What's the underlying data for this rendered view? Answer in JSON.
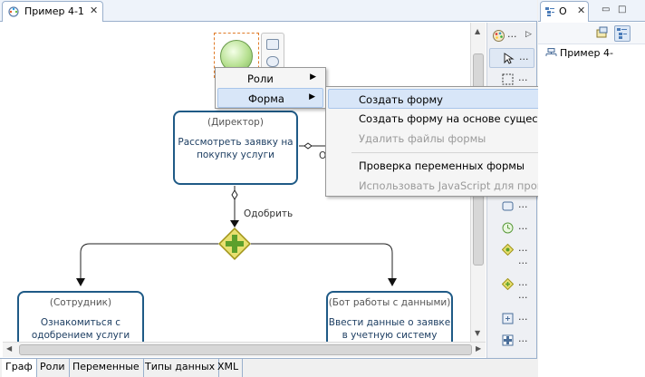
{
  "editor": {
    "tab_title": "Пример 4-1",
    "close_glyph": "✕",
    "bottom_tabs": [
      "Граф",
      "Роли",
      "Переменные",
      "Типы данных",
      "XML"
    ],
    "active_bottom_tab": 0
  },
  "diagram": {
    "tasks": [
      {
        "role": "(Директор)",
        "name": "Рассмотреть заявку на покупку услуги"
      },
      {
        "role": "(Сотрудник)",
        "name": "Ознакомиться с одобрением услуги"
      },
      {
        "role": "(Бот работы с данными)",
        "name": "Ввести данные о заявке в учетную систему"
      }
    ],
    "edge_label": "Одобрить",
    "cut_label": "О"
  },
  "context_menu": {
    "items": [
      {
        "label": "Роли",
        "has_submenu": true
      },
      {
        "label": "Форма",
        "has_submenu": true
      }
    ],
    "submenu": [
      {
        "label": "Создать форму",
        "enabled": true,
        "hover": true
      },
      {
        "label": "Создать форму на основе существующей",
        "enabled": true
      },
      {
        "label": "Удалить файлы формы",
        "enabled": false
      },
      {
        "label": "Проверка переменных формы",
        "enabled": true
      },
      {
        "label": "Использовать JavaScript для проверки формы",
        "enabled": false
      }
    ]
  },
  "palette": {
    "dots": "...",
    "items": [
      "palette-color-icon",
      "select-icon",
      "marquee-icon",
      "task-icon",
      "timer-icon",
      "gateway-icon",
      "gateway-icon",
      "subprocess-icon",
      "end-icon"
    ]
  },
  "outline": {
    "tab_title": "O",
    "close_glyph": "✕",
    "item": "Пример 4-"
  },
  "colors": {
    "task_border": "#1f5a86",
    "gateway_fill": "#e8e070",
    "gateway_cross": "#5ca02c",
    "start_fill": "#b6e090",
    "menu_hover": "#d8e6f8"
  }
}
